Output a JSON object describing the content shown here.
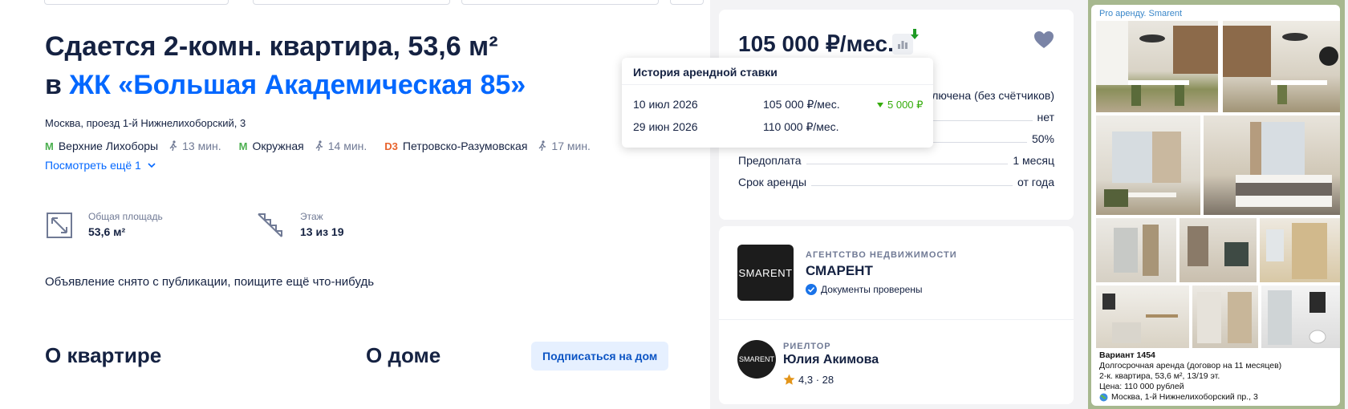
{
  "listing": {
    "title_line1": "Сдается 2-комн. квартира, 53,6 м²",
    "title_prefix": "в ",
    "title_link": "ЖК «Большая Академическая 85»",
    "address": "Москва, проезд 1-й Нижнелихоборский, 3",
    "metro": [
      {
        "name": "Верхние Лихоборы",
        "walk": "13 мин.",
        "icon": "metro-m-icon",
        "color": "#4caf50"
      },
      {
        "name": "Окружная",
        "walk": "14 мин.",
        "icon": "metro-m-icon",
        "color": "#4caf50"
      },
      {
        "name": "Петровско-Разумовская",
        "walk": "17 мин.",
        "icon": "d3-icon",
        "color": "#e8632d"
      }
    ],
    "metro_badges": {
      "m": "M",
      "d3": "D3"
    },
    "more_label": "Посмотреть ещё 1",
    "area_label": "Общая площадь",
    "area_value": "53,6 м²",
    "floor_label": "Этаж",
    "floor_value": "13 из 19",
    "notice": "Объявление снято с публикации, поищите ещё что-нибудь",
    "about_flat": "О квартире",
    "about_house": "О доме",
    "subscribe_label": "Подписаться на дом"
  },
  "price": {
    "value": "105 000 ₽/мес.",
    "rows": [
      {
        "label": "",
        "value": "ключена (без счётчиков)"
      },
      {
        "label": "",
        "value": "нет"
      },
      {
        "label": "",
        "value": "50%"
      },
      {
        "label": "Предоплата",
        "value": "1 месяц"
      },
      {
        "label": "Срок аренды",
        "value": "от года"
      }
    ]
  },
  "history": {
    "title": "История арендной ставки",
    "rows": [
      {
        "date": "10 июл 2026",
        "amount": "105 000 ₽/мес.",
        "change": "5 000 ₽"
      },
      {
        "date": "29 июн 2026",
        "amount": "110 000 ₽/мес.",
        "change": ""
      }
    ]
  },
  "agency": {
    "logo_text": "SMARENT",
    "label": "АГЕНТСТВО НЕДВИЖИМОСТИ",
    "name": "СМАРЕНТ",
    "docs": "Документы проверены"
  },
  "realtor": {
    "logo_text": "SMARENT",
    "label": "РИЕЛТОР",
    "name": "Юлия Акимова",
    "rating": "4,3",
    "reviews": "28",
    "rating_sep": "·"
  },
  "telegram": {
    "source": "Pro аренду. Smarent",
    "lines": [
      "Вариант 1454",
      "Долгосрочная аренда (договор на 11 месяцев)",
      "2-к. квартира, 53,6 м², 13/19 эт.",
      "Цена: 110 000 рублей",
      "Москва, 1-й Нижнелихоборский пр., 3"
    ]
  },
  "colors": {
    "accent": "#0468ff",
    "text": "#152242",
    "muted": "#707a95",
    "green": "#34ac0a",
    "star": "#e3951a"
  }
}
